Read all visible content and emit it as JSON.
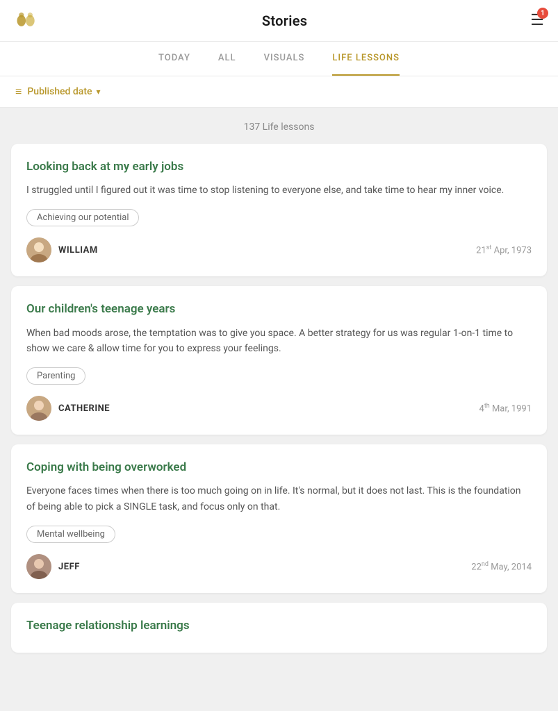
{
  "header": {
    "title": "Stories",
    "notification_count": "1"
  },
  "nav": {
    "tabs": [
      {
        "id": "today",
        "label": "TODAY",
        "active": false
      },
      {
        "id": "all",
        "label": "ALL",
        "active": false
      },
      {
        "id": "visuals",
        "label": "VISUALS",
        "active": false
      },
      {
        "id": "life-lessons",
        "label": "LIFE LESSONS",
        "active": true
      }
    ]
  },
  "filter": {
    "label": "Published date"
  },
  "stories_count": "137 Life lessons",
  "stories": [
    {
      "id": "story-1",
      "title": "Looking back at my early jobs",
      "excerpt": "I struggled until I figured out it was time to stop listening to everyone else, and take time to hear my inner voice.",
      "tag": "Achieving our potential",
      "author": "WILLIAM",
      "author_id": "william",
      "date": "21",
      "date_suffix": "st",
      "date_rest": " Apr, 1973"
    },
    {
      "id": "story-2",
      "title": "Our children's teenage years",
      "excerpt": "When bad moods arose, the temptation was to give you space. A better strategy for us was regular 1-on-1 time to show we care & allow time for you to express your feelings.",
      "tag": "Parenting",
      "author": "CATHERINE",
      "author_id": "catherine",
      "date": "4",
      "date_suffix": "th",
      "date_rest": " Mar, 1991"
    },
    {
      "id": "story-3",
      "title": "Coping with being overworked",
      "excerpt": "Everyone faces times when there is too much going on in life. It's normal, but it does not last. This is the foundation of being able to pick a SINGLE task, and focus only on that.",
      "tag": "Mental wellbeing",
      "author": "JEFF",
      "author_id": "jeff",
      "date": "22",
      "date_suffix": "nd",
      "date_rest": " May, 2014"
    },
    {
      "id": "story-4",
      "title": "Teenage relationship learnings",
      "excerpt": "",
      "tag": "",
      "author": "",
      "author_id": "",
      "date": "",
      "date_suffix": "",
      "date_rest": ""
    }
  ]
}
